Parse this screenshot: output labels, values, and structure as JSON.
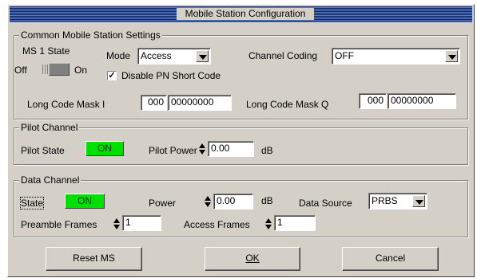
{
  "window": {
    "title": "Mobile Station Configuration"
  },
  "common": {
    "label": "Common Mobile Station Settings",
    "ms_state_label": "MS 1 State",
    "toggle_off": "Off",
    "toggle_on": "On",
    "mode_label": "Mode",
    "mode_value": "Access",
    "channel_coding_label": "Channel Coding",
    "channel_coding_value": "OFF",
    "disable_pn_checked": true,
    "disable_pn_label": "Disable PN Short Code",
    "long_code_i_label": "Long Code Mask I",
    "long_code_i_hi": "000",
    "long_code_i_lo": "00000000",
    "long_code_q_label": "Long Code Mask Q",
    "long_code_q_hi": "000",
    "long_code_q_lo": "00000000"
  },
  "pilot": {
    "label": "Pilot Channel",
    "state_label": "Pilot State",
    "state_value": "ON",
    "power_label": "Pilot Power",
    "power_value": "0.00",
    "power_unit": "dB"
  },
  "data": {
    "label": "Data Channel",
    "state_label": "State",
    "state_value": "ON",
    "power_label": "Power",
    "power_value": "0.00",
    "power_unit": "dB",
    "source_label": "Data Source",
    "source_value": "PRBS",
    "preamble_label": "Preamble Frames",
    "preamble_value": "1",
    "access_label": "Access Frames",
    "access_value": "1"
  },
  "buttons": {
    "reset": "Reset MS",
    "ok": "OK",
    "cancel": "Cancel"
  },
  "colors": {
    "state_on": "#00e000",
    "titlebar": "#0a246a",
    "face": "#d4d0c8"
  }
}
